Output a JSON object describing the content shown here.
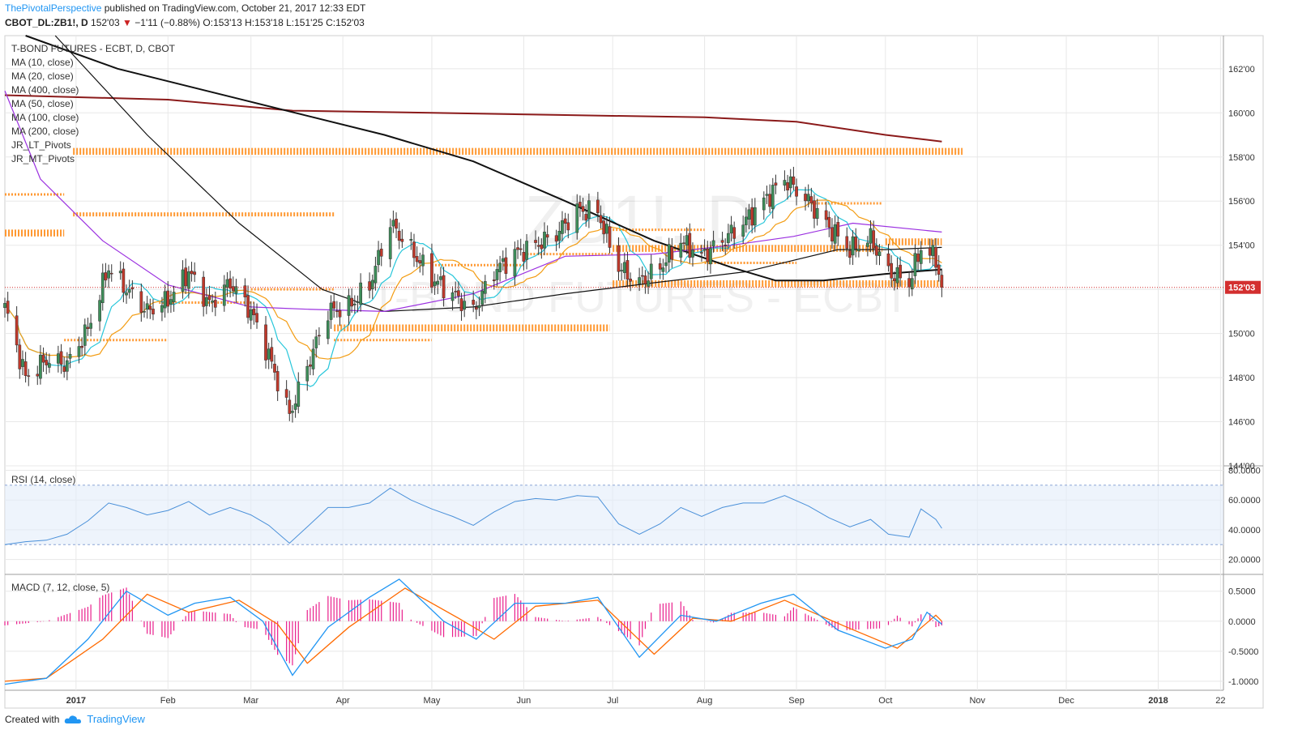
{
  "header": {
    "author": "ThePivotalPerspective",
    "published_text": " published on TradingView.com, October 21, 2017 12:33 EDT",
    "symbol": "CBOT_DL:ZB1!, D",
    "last": "152'03",
    "change": "−1'11 (−0.88%)",
    "open_label": "O:",
    "open": "153'13",
    "high_label": "H:",
    "high": "153'18",
    "low_label": "L:",
    "low": "151'25",
    "close_label": "C:",
    "close": "152'03"
  },
  "legend": [
    "T-BOND FUTURES - ECBT, D, CBOT",
    "MA (10, close)",
    "MA (20, close)",
    "MA (400, close)",
    "MA (50, close)",
    "MA (100, close)",
    "MA (200, close)",
    "JR_LT_Pivots",
    "JR_MT_Pivots"
  ],
  "watermark": {
    "symbol": "ZB1!, D",
    "name": "T-BOND FUTURES - ECBT"
  },
  "footer": {
    "created_with": "Created with",
    "brand": "TradingView"
  },
  "colors": {
    "up": "#3e8e5a",
    "down": "#c0392b",
    "ma10": "#26c6da",
    "ma20": "#f39c12",
    "ma400": "#8b1a1a",
    "ma50": "#9b30e0",
    "ma100": "#111111",
    "ma200": "#111111",
    "pivot": "#ff9933",
    "rsi": "#4a90d9",
    "macd": "#2196f3",
    "signal": "#ff6a00",
    "hist": "#e91e8c",
    "grid": "#e8e8e8",
    "last_price": "#d32f2f"
  },
  "chart_data": [
    {
      "type": "candlestick",
      "title": "T-BOND FUTURES - ECBT, D, CBOT",
      "ylim": [
        144,
        163.5
      ],
      "y_ticks": [
        144,
        146,
        148,
        150,
        152,
        154,
        156,
        158,
        160,
        162
      ],
      "y_tick_labels": [
        "144'00",
        "146'00",
        "148'00",
        "150'00",
        "152'00",
        "154'00",
        "156'00",
        "158'00",
        "160'00",
        "162'00"
      ],
      "last_price": 152.09,
      "last_price_label": "152'03",
      "x_range": [
        "2016-12-08",
        "2018-01-23"
      ],
      "x_ticks": [
        "2017",
        "Feb",
        "Mar",
        "Apr",
        "May",
        "Jun",
        "Jul",
        "Aug",
        "Sep",
        "Oct",
        "Nov",
        "Dec",
        "2018",
        "22"
      ],
      "x_tick_dates": [
        "2017-01-01",
        "2017-02-01",
        "2017-03-01",
        "2017-04-01",
        "2017-05-01",
        "2017-06-01",
        "2017-07-01",
        "2017-08-01",
        "2017-09-01",
        "2017-10-01",
        "2017-11-01",
        "2017-12-01",
        "2018-01-01",
        "2018-01-22"
      ],
      "close_anchors": [
        [
          "2016-12-08",
          151.2
        ],
        [
          "2016-12-15",
          148.0
        ],
        [
          "2016-12-22",
          148.8
        ],
        [
          "2016-12-29",
          148.6
        ],
        [
          "2017-01-05",
          150.2
        ],
        [
          "2017-01-12",
          153.0
        ],
        [
          "2017-01-18",
          152.0
        ],
        [
          "2017-01-25",
          151.0
        ],
        [
          "2017-02-01",
          151.5
        ],
        [
          "2017-02-08",
          152.8
        ],
        [
          "2017-02-15",
          151.3
        ],
        [
          "2017-02-22",
          152.3
        ],
        [
          "2017-03-01",
          151.0
        ],
        [
          "2017-03-07",
          149.0
        ],
        [
          "2017-03-14",
          146.3
        ],
        [
          "2017-03-20",
          148.5
        ],
        [
          "2017-03-27",
          151.0
        ],
        [
          "2017-04-03",
          151.2
        ],
        [
          "2017-04-10",
          152.2
        ],
        [
          "2017-04-17",
          155.0
        ],
        [
          "2017-04-24",
          153.8
        ],
        [
          "2017-05-01",
          152.5
        ],
        [
          "2017-05-08",
          151.8
        ],
        [
          "2017-05-15",
          151.0
        ],
        [
          "2017-05-22",
          152.8
        ],
        [
          "2017-05-29",
          153.6
        ],
        [
          "2017-06-05",
          154.0
        ],
        [
          "2017-06-12",
          154.5
        ],
        [
          "2017-06-19",
          155.6
        ],
        [
          "2017-06-26",
          155.5
        ],
        [
          "2017-07-03",
          153.0
        ],
        [
          "2017-07-10",
          152.3
        ],
        [
          "2017-07-17",
          153.0
        ],
        [
          "2017-07-24",
          154.2
        ],
        [
          "2017-07-31",
          153.5
        ],
        [
          "2017-08-07",
          154.2
        ],
        [
          "2017-08-14",
          155.0
        ],
        [
          "2017-08-21",
          156.0
        ],
        [
          "2017-08-28",
          157.0
        ],
        [
          "2017-09-05",
          156.0
        ],
        [
          "2017-09-12",
          154.8
        ],
        [
          "2017-09-19",
          153.8
        ],
        [
          "2017-09-26",
          154.3
        ],
        [
          "2017-10-02",
          152.8
        ],
        [
          "2017-10-09",
          152.3
        ],
        [
          "2017-10-13",
          153.9
        ],
        [
          "2017-10-18",
          153.4
        ],
        [
          "2017-10-20",
          152.09
        ]
      ],
      "moving_averages": [
        {
          "name": "MA (400, close)",
          "points": [
            [
              "2016-12-08",
              160.8
            ],
            [
              "2017-02-01",
              160.6
            ],
            [
              "2017-03-15",
              160.1
            ],
            [
              "2017-05-01",
              160.0
            ],
            [
              "2017-06-15",
              159.9
            ],
            [
              "2017-08-01",
              159.8
            ],
            [
              "2017-09-01",
              159.6
            ],
            [
              "2017-10-01",
              159.0
            ],
            [
              "2017-10-20",
              158.7
            ]
          ]
        },
        {
          "name": "MA (200, close)",
          "points": [
            [
              "2016-12-15",
              163.5
            ],
            [
              "2017-01-15",
              162.0
            ],
            [
              "2017-03-01",
              160.5
            ],
            [
              "2017-04-15",
              159.0
            ],
            [
              "2017-05-15",
              157.8
            ],
            [
              "2017-06-15",
              156.0
            ],
            [
              "2017-07-15",
              154.2
            ],
            [
              "2017-08-10",
              153.0
            ],
            [
              "2017-08-25",
              152.4
            ],
            [
              "2017-09-10",
              152.4
            ],
            [
              "2017-10-01",
              152.7
            ],
            [
              "2017-10-20",
              152.9
            ]
          ]
        },
        {
          "name": "MA (100, close)",
          "points": [
            [
              "2016-12-25",
              163.5
            ],
            [
              "2017-01-25",
              159.0
            ],
            [
              "2017-02-25",
              155.0
            ],
            [
              "2017-03-25",
              152.0
            ],
            [
              "2017-04-15",
              151.0
            ],
            [
              "2017-05-15",
              151.2
            ],
            [
              "2017-06-15",
              151.8
            ],
            [
              "2017-07-15",
              152.3
            ],
            [
              "2017-08-15",
              152.8
            ],
            [
              "2017-09-15",
              153.8
            ],
            [
              "2017-10-01",
              153.8
            ],
            [
              "2017-10-20",
              153.9
            ]
          ]
        },
        {
          "name": "MA (50, close)",
          "points": [
            [
              "2016-12-08",
              161.0
            ],
            [
              "2016-12-20",
              157.0
            ],
            [
              "2017-01-10",
              154.2
            ],
            [
              "2017-02-01",
              152.2
            ],
            [
              "2017-03-01",
              151.2
            ],
            [
              "2017-03-20",
              151.1
            ],
            [
              "2017-04-15",
              151.0
            ],
            [
              "2017-05-15",
              151.8
            ],
            [
              "2017-06-15",
              153.5
            ],
            [
              "2017-07-15",
              153.6
            ],
            [
              "2017-08-10",
              154.0
            ],
            [
              "2017-08-31",
              154.4
            ],
            [
              "2017-09-20",
              155.0
            ],
            [
              "2017-10-20",
              154.6
            ]
          ]
        }
      ],
      "pivot_levels": [
        {
          "level": 158.3,
          "from": "2016-12-31",
          "to": "2017-10-27",
          "weight": "heavy"
        },
        {
          "level": 155.4,
          "from": "2016-12-31",
          "to": "2017-03-29",
          "weight": "medium"
        },
        {
          "level": 154.6,
          "from": "2016-12-08",
          "to": "2016-12-28",
          "weight": "heavy"
        },
        {
          "level": 156.3,
          "from": "2016-12-08",
          "to": "2016-12-28",
          "weight": "light"
        },
        {
          "level": 150.3,
          "from": "2017-03-29",
          "to": "2017-06-30",
          "weight": "heavy"
        },
        {
          "level": 149.7,
          "from": "2017-03-29",
          "to": "2017-05-01",
          "weight": "light"
        },
        {
          "level": 149.7,
          "from": "2016-12-28",
          "to": "2017-02-01",
          "weight": "light"
        },
        {
          "level": 151.4,
          "from": "2017-01-29",
          "to": "2017-03-02",
          "weight": "light"
        },
        {
          "level": 152.0,
          "from": "2017-03-01",
          "to": "2017-03-29",
          "weight": "light"
        },
        {
          "level": 153.1,
          "from": "2017-05-01",
          "to": "2017-06-01",
          "weight": "light"
        },
        {
          "level": 153.6,
          "from": "2017-06-01",
          "to": "2017-07-01",
          "weight": "light"
        },
        {
          "level": 154.7,
          "from": "2017-07-01",
          "to": "2017-08-01",
          "weight": "light"
        },
        {
          "level": 153.9,
          "from": "2017-07-01",
          "to": "2017-09-30",
          "weight": "heavy"
        },
        {
          "level": 152.3,
          "from": "2017-07-01",
          "to": "2017-10-20",
          "weight": "heavy"
        },
        {
          "level": 153.2,
          "from": "2017-08-01",
          "to": "2017-09-01",
          "weight": "light"
        },
        {
          "level": 155.9,
          "from": "2017-09-05",
          "to": "2017-09-30",
          "weight": "light"
        },
        {
          "level": 154.2,
          "from": "2017-10-01",
          "to": "2017-10-20",
          "weight": "heavy"
        }
      ]
    },
    {
      "type": "line",
      "title": "RSI (14, close)",
      "ylim": [
        10,
        83
      ],
      "y_ticks": [
        20,
        40,
        60,
        80
      ],
      "y_tick_labels": [
        "20.0000",
        "40.0000",
        "60.0000",
        "80.0000"
      ],
      "band": [
        30,
        70
      ],
      "series": [
        {
          "name": "RSI",
          "points": [
            [
              "2016-12-08",
              30
            ],
            [
              "2016-12-15",
              32
            ],
            [
              "2016-12-22",
              33
            ],
            [
              "2016-12-29",
              37
            ],
            [
              "2017-01-05",
              46
            ],
            [
              "2017-01-12",
              58
            ],
            [
              "2017-01-18",
              55
            ],
            [
              "2017-01-25",
              50
            ],
            [
              "2017-02-01",
              53
            ],
            [
              "2017-02-08",
              59
            ],
            [
              "2017-02-15",
              50
            ],
            [
              "2017-02-22",
              55
            ],
            [
              "2017-03-01",
              50
            ],
            [
              "2017-03-07",
              43
            ],
            [
              "2017-03-14",
              31
            ],
            [
              "2017-03-20",
              42
            ],
            [
              "2017-03-27",
              55
            ],
            [
              "2017-04-03",
              55
            ],
            [
              "2017-04-10",
              58
            ],
            [
              "2017-04-17",
              68
            ],
            [
              "2017-04-24",
              60
            ],
            [
              "2017-05-01",
              54
            ],
            [
              "2017-05-08",
              49
            ],
            [
              "2017-05-15",
              43
            ],
            [
              "2017-05-22",
              52
            ],
            [
              "2017-05-29",
              59
            ],
            [
              "2017-06-05",
              61
            ],
            [
              "2017-06-12",
              60
            ],
            [
              "2017-06-19",
              63
            ],
            [
              "2017-06-26",
              62
            ],
            [
              "2017-07-03",
              44
            ],
            [
              "2017-07-10",
              37
            ],
            [
              "2017-07-17",
              44
            ],
            [
              "2017-07-24",
              55
            ],
            [
              "2017-07-31",
              49
            ],
            [
              "2017-08-07",
              55
            ],
            [
              "2017-08-14",
              58
            ],
            [
              "2017-08-21",
              58
            ],
            [
              "2017-08-28",
              63
            ],
            [
              "2017-09-05",
              56
            ],
            [
              "2017-09-12",
              48
            ],
            [
              "2017-09-19",
              42
            ],
            [
              "2017-09-26",
              47
            ],
            [
              "2017-10-02",
              37
            ],
            [
              "2017-10-09",
              35
            ],
            [
              "2017-10-13",
              54
            ],
            [
              "2017-10-18",
              47
            ],
            [
              "2017-10-20",
              41
            ]
          ]
        }
      ]
    },
    {
      "type": "macd",
      "title": "MACD (7, 12, close, 5)",
      "ylim": [
        -1.15,
        0.78
      ],
      "y_ticks": [
        -1.0,
        -0.5,
        0.0,
        0.5
      ],
      "y_tick_labels": [
        "-1.0000",
        "-0.5000",
        "0.0000",
        "0.5000"
      ],
      "series": [
        {
          "name": "MACD",
          "points": [
            [
              "2016-12-08",
              -1.05
            ],
            [
              "2016-12-22",
              -0.95
            ],
            [
              "2017-01-05",
              -0.3
            ],
            [
              "2017-01-18",
              0.5
            ],
            [
              "2017-02-01",
              0.1
            ],
            [
              "2017-02-10",
              0.3
            ],
            [
              "2017-02-22",
              0.4
            ],
            [
              "2017-03-05",
              0.0
            ],
            [
              "2017-03-15",
              -0.9
            ],
            [
              "2017-03-27",
              -0.1
            ],
            [
              "2017-04-10",
              0.4
            ],
            [
              "2017-04-20",
              0.7
            ],
            [
              "2017-05-05",
              0.0
            ],
            [
              "2017-05-16",
              -0.3
            ],
            [
              "2017-05-29",
              0.3
            ],
            [
              "2017-06-15",
              0.3
            ],
            [
              "2017-06-26",
              0.4
            ],
            [
              "2017-07-10",
              -0.6
            ],
            [
              "2017-07-24",
              0.1
            ],
            [
              "2017-08-05",
              0.0
            ],
            [
              "2017-08-20",
              0.3
            ],
            [
              "2017-08-31",
              0.45
            ],
            [
              "2017-09-15",
              -0.15
            ],
            [
              "2017-10-01",
              -0.45
            ],
            [
              "2017-10-10",
              -0.3
            ],
            [
              "2017-10-15",
              0.15
            ],
            [
              "2017-10-20",
              -0.05
            ]
          ]
        },
        {
          "name": "Signal",
          "points": [
            [
              "2016-12-08",
              -1.0
            ],
            [
              "2016-12-22",
              -0.95
            ],
            [
              "2017-01-10",
              -0.3
            ],
            [
              "2017-01-25",
              0.45
            ],
            [
              "2017-02-08",
              0.15
            ],
            [
              "2017-02-25",
              0.35
            ],
            [
              "2017-03-10",
              -0.05
            ],
            [
              "2017-03-20",
              -0.7
            ],
            [
              "2017-04-03",
              -0.1
            ],
            [
              "2017-04-22",
              0.55
            ],
            [
              "2017-05-10",
              0.05
            ],
            [
              "2017-05-22",
              -0.3
            ],
            [
              "2017-06-05",
              0.25
            ],
            [
              "2017-06-26",
              0.35
            ],
            [
              "2017-07-15",
              -0.55
            ],
            [
              "2017-07-28",
              0.05
            ],
            [
              "2017-08-10",
              0.0
            ],
            [
              "2017-08-28",
              0.35
            ],
            [
              "2017-09-18",
              -0.1
            ],
            [
              "2017-10-05",
              -0.45
            ],
            [
              "2017-10-18",
              0.1
            ],
            [
              "2017-10-20",
              0.0
            ]
          ]
        }
      ]
    }
  ]
}
